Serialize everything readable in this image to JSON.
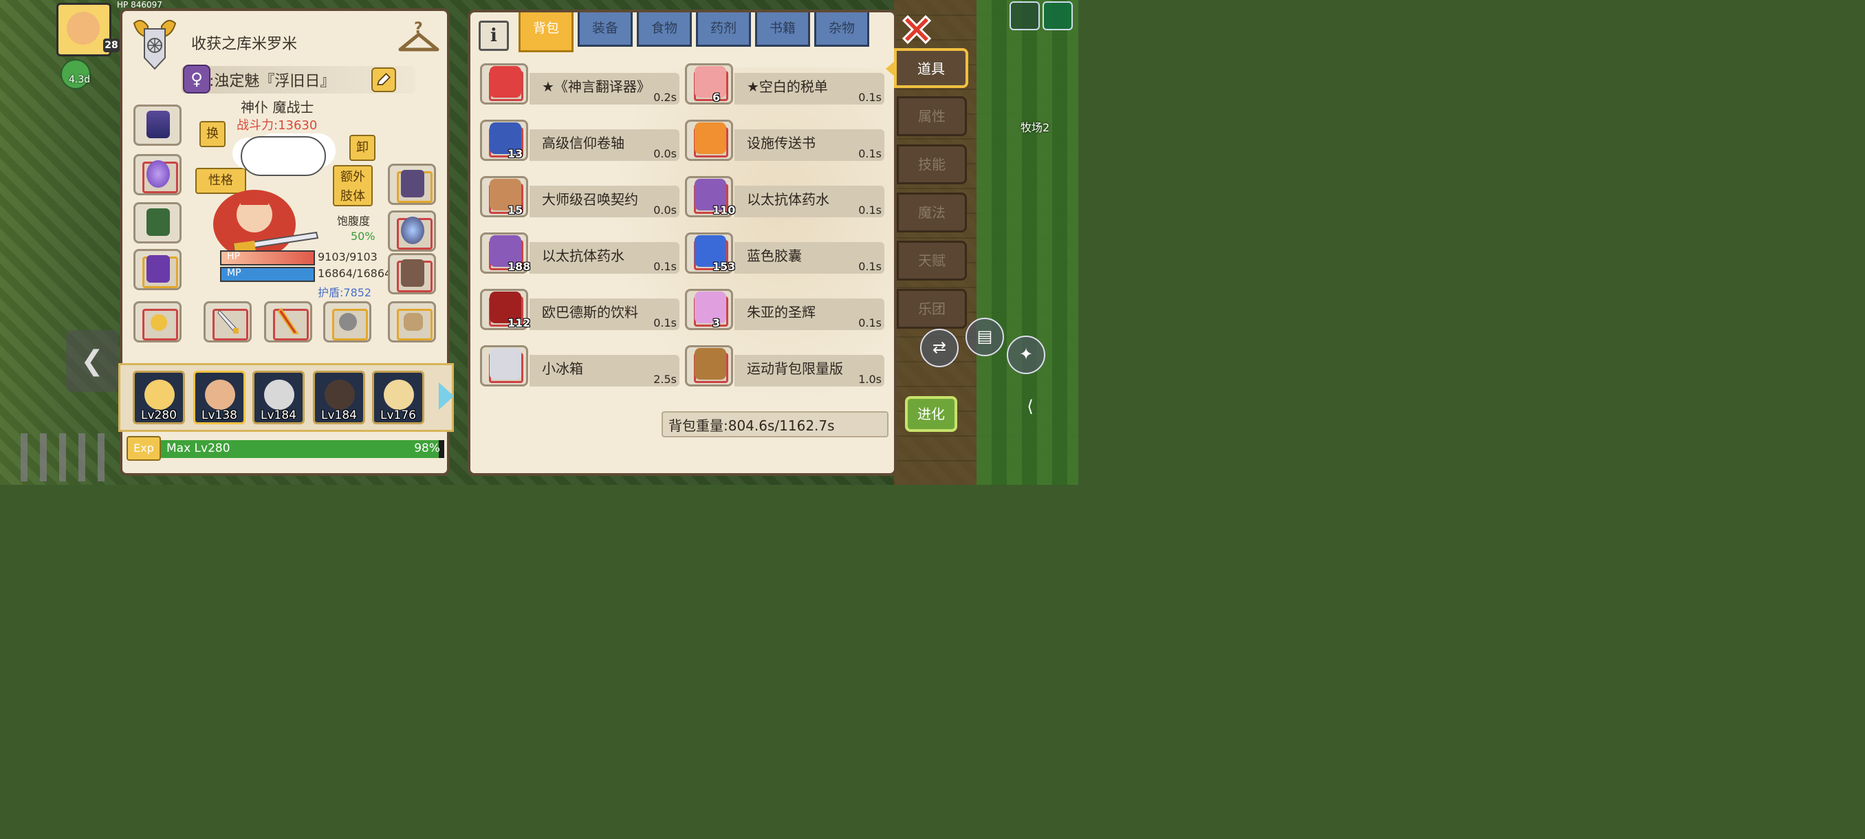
{
  "hud": {
    "level": "28",
    "buff_time": "4.3d",
    "hp_text": "HP    846097"
  },
  "character": {
    "name": "收获之库米罗米",
    "gender_symbol": "♀",
    "title": ":浊定魅『浮旧日』",
    "job": "神仆 魔战士",
    "power": "战斗力:13630",
    "swap_label": "换",
    "unequip_label": "卸",
    "trait_label": "性格",
    "extra_limb_label_1": "额外",
    "extra_limb_label_2": "肢体",
    "satiety_label": "饱腹度",
    "satiety_value": "50%",
    "hp_label": "HP",
    "hp_value": "9103/9103",
    "hp_fraction": 1.0,
    "mp_label": "MP",
    "mp_value": "16864/16864",
    "mp_fraction": 1.0,
    "shield": "护盾:7852"
  },
  "party": {
    "members": [
      {
        "level": "Lv280",
        "color": "#f4cf6b"
      },
      {
        "level": "Lv138",
        "color": "#e7b48b"
      },
      {
        "level": "Lv184",
        "color": "#d8d8d8"
      },
      {
        "level": "Lv184",
        "color": "#4b3a32"
      },
      {
        "level": "Lv176",
        "color": "#f0d79a"
      }
    ]
  },
  "exp": {
    "tag": "Exp",
    "text": "Max Lv280",
    "percent": "98%",
    "fraction": 0.98
  },
  "inventory": {
    "tabs": [
      "背包",
      "装备",
      "食物",
      "药剂",
      "书籍",
      "杂物"
    ],
    "active_tab": 0,
    "items": [
      {
        "name": "★《神言翻译器》",
        "weight": "0.2s",
        "count": "",
        "icon": "translator-icon",
        "color": "#e04040"
      },
      {
        "name": "★空白的税单",
        "weight": "0.1s",
        "count": "6",
        "icon": "tax-form-icon",
        "color": "#f0a0a0"
      },
      {
        "name": "高级信仰卷轴",
        "weight": "0.0s",
        "count": "13",
        "icon": "scroll-icon",
        "color": "#3a5ab8"
      },
      {
        "name": "设施传送书",
        "weight": "0.1s",
        "count": "",
        "icon": "teleport-book-icon",
        "color": "#f09030"
      },
      {
        "name": "大师级召唤契约",
        "weight": "0.0s",
        "count": "15",
        "icon": "contract-icon",
        "color": "#c98a5a"
      },
      {
        "name": "以太抗体药水",
        "weight": "0.1s",
        "count": "110",
        "icon": "potion-icon",
        "color": "#8a5ab8"
      },
      {
        "name": "以太抗体药水",
        "weight": "0.1s",
        "count": "188",
        "icon": "potion-icon",
        "color": "#8a5ab8"
      },
      {
        "name": "蓝色胶囊",
        "weight": "0.1s",
        "count": "153",
        "icon": "capsule-icon",
        "color": "#3a6ad8"
      },
      {
        "name": "欧巴德斯的饮料",
        "weight": "0.1s",
        "count": "112",
        "icon": "drink-bottle-icon",
        "color": "#a02020"
      },
      {
        "name": "朱亚的圣辉",
        "weight": "0.1s",
        "count": "3",
        "icon": "holy-flask-icon",
        "color": "#e0a0e0"
      },
      {
        "name": "小冰箱",
        "weight": "2.5s",
        "count": "",
        "icon": "fridge-icon",
        "color": "#d8d8e0"
      },
      {
        "name": "运动背包限量版",
        "weight": "1.0s",
        "count": "",
        "icon": "backpack-icon",
        "color": "#b07a3a"
      }
    ],
    "bag_weight": "背包重量:804.6s/1162.7s"
  },
  "side_tabs": [
    "道具",
    "属性",
    "技能",
    "魔法",
    "天赋",
    "乐团"
  ],
  "side_active": 0,
  "evolve_label": "进化",
  "map_label": "牧场2"
}
